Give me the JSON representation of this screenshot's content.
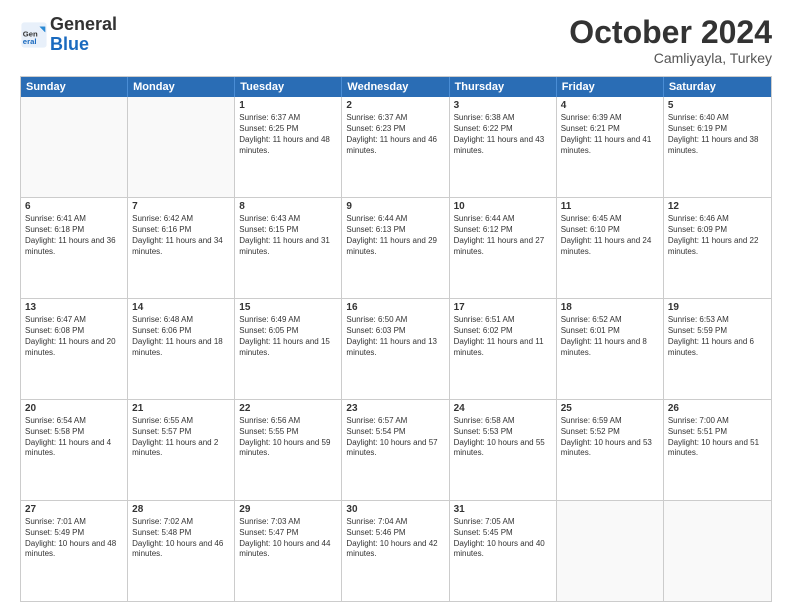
{
  "header": {
    "logo_general": "General",
    "logo_blue": "Blue",
    "month_title": "October 2024",
    "subtitle": "Camliyayla, Turkey"
  },
  "weekdays": [
    "Sunday",
    "Monday",
    "Tuesday",
    "Wednesday",
    "Thursday",
    "Friday",
    "Saturday"
  ],
  "weeks": [
    [
      {
        "day": "",
        "info": ""
      },
      {
        "day": "",
        "info": ""
      },
      {
        "day": "1",
        "info": "Sunrise: 6:37 AM\nSunset: 6:25 PM\nDaylight: 11 hours and 48 minutes."
      },
      {
        "day": "2",
        "info": "Sunrise: 6:37 AM\nSunset: 6:23 PM\nDaylight: 11 hours and 46 minutes."
      },
      {
        "day": "3",
        "info": "Sunrise: 6:38 AM\nSunset: 6:22 PM\nDaylight: 11 hours and 43 minutes."
      },
      {
        "day": "4",
        "info": "Sunrise: 6:39 AM\nSunset: 6:21 PM\nDaylight: 11 hours and 41 minutes."
      },
      {
        "day": "5",
        "info": "Sunrise: 6:40 AM\nSunset: 6:19 PM\nDaylight: 11 hours and 38 minutes."
      }
    ],
    [
      {
        "day": "6",
        "info": "Sunrise: 6:41 AM\nSunset: 6:18 PM\nDaylight: 11 hours and 36 minutes."
      },
      {
        "day": "7",
        "info": "Sunrise: 6:42 AM\nSunset: 6:16 PM\nDaylight: 11 hours and 34 minutes."
      },
      {
        "day": "8",
        "info": "Sunrise: 6:43 AM\nSunset: 6:15 PM\nDaylight: 11 hours and 31 minutes."
      },
      {
        "day": "9",
        "info": "Sunrise: 6:44 AM\nSunset: 6:13 PM\nDaylight: 11 hours and 29 minutes."
      },
      {
        "day": "10",
        "info": "Sunrise: 6:44 AM\nSunset: 6:12 PM\nDaylight: 11 hours and 27 minutes."
      },
      {
        "day": "11",
        "info": "Sunrise: 6:45 AM\nSunset: 6:10 PM\nDaylight: 11 hours and 24 minutes."
      },
      {
        "day": "12",
        "info": "Sunrise: 6:46 AM\nSunset: 6:09 PM\nDaylight: 11 hours and 22 minutes."
      }
    ],
    [
      {
        "day": "13",
        "info": "Sunrise: 6:47 AM\nSunset: 6:08 PM\nDaylight: 11 hours and 20 minutes."
      },
      {
        "day": "14",
        "info": "Sunrise: 6:48 AM\nSunset: 6:06 PM\nDaylight: 11 hours and 18 minutes."
      },
      {
        "day": "15",
        "info": "Sunrise: 6:49 AM\nSunset: 6:05 PM\nDaylight: 11 hours and 15 minutes."
      },
      {
        "day": "16",
        "info": "Sunrise: 6:50 AM\nSunset: 6:03 PM\nDaylight: 11 hours and 13 minutes."
      },
      {
        "day": "17",
        "info": "Sunrise: 6:51 AM\nSunset: 6:02 PM\nDaylight: 11 hours and 11 minutes."
      },
      {
        "day": "18",
        "info": "Sunrise: 6:52 AM\nSunset: 6:01 PM\nDaylight: 11 hours and 8 minutes."
      },
      {
        "day": "19",
        "info": "Sunrise: 6:53 AM\nSunset: 5:59 PM\nDaylight: 11 hours and 6 minutes."
      }
    ],
    [
      {
        "day": "20",
        "info": "Sunrise: 6:54 AM\nSunset: 5:58 PM\nDaylight: 11 hours and 4 minutes."
      },
      {
        "day": "21",
        "info": "Sunrise: 6:55 AM\nSunset: 5:57 PM\nDaylight: 11 hours and 2 minutes."
      },
      {
        "day": "22",
        "info": "Sunrise: 6:56 AM\nSunset: 5:55 PM\nDaylight: 10 hours and 59 minutes."
      },
      {
        "day": "23",
        "info": "Sunrise: 6:57 AM\nSunset: 5:54 PM\nDaylight: 10 hours and 57 minutes."
      },
      {
        "day": "24",
        "info": "Sunrise: 6:58 AM\nSunset: 5:53 PM\nDaylight: 10 hours and 55 minutes."
      },
      {
        "day": "25",
        "info": "Sunrise: 6:59 AM\nSunset: 5:52 PM\nDaylight: 10 hours and 53 minutes."
      },
      {
        "day": "26",
        "info": "Sunrise: 7:00 AM\nSunset: 5:51 PM\nDaylight: 10 hours and 51 minutes."
      }
    ],
    [
      {
        "day": "27",
        "info": "Sunrise: 7:01 AM\nSunset: 5:49 PM\nDaylight: 10 hours and 48 minutes."
      },
      {
        "day": "28",
        "info": "Sunrise: 7:02 AM\nSunset: 5:48 PM\nDaylight: 10 hours and 46 minutes."
      },
      {
        "day": "29",
        "info": "Sunrise: 7:03 AM\nSunset: 5:47 PM\nDaylight: 10 hours and 44 minutes."
      },
      {
        "day": "30",
        "info": "Sunrise: 7:04 AM\nSunset: 5:46 PM\nDaylight: 10 hours and 42 minutes."
      },
      {
        "day": "31",
        "info": "Sunrise: 7:05 AM\nSunset: 5:45 PM\nDaylight: 10 hours and 40 minutes."
      },
      {
        "day": "",
        "info": ""
      },
      {
        "day": "",
        "info": ""
      }
    ]
  ]
}
